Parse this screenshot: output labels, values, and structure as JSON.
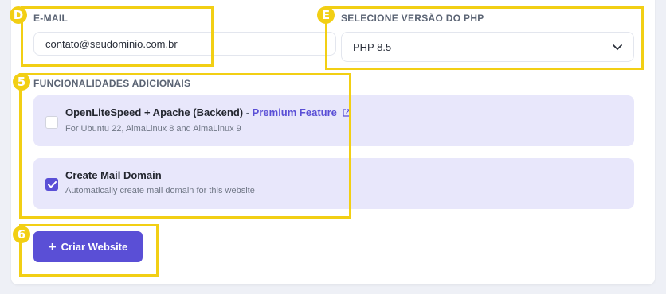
{
  "email": {
    "label": "E-MAIL",
    "value": "contato@seudominio.com.br"
  },
  "php": {
    "label": "SELECIONE VERSÃO DO PHP",
    "selected": "PHP 8.5"
  },
  "features": {
    "label": "FUNCIONALIDADES ADICIONAIS",
    "items": [
      {
        "title": "OpenLiteSpeed + Apache (Backend)",
        "separator": " - ",
        "premium": "Premium Feature",
        "description": "For Ubuntu 22, AlmaLinux 8 and AlmaLinux 9",
        "checked": false
      },
      {
        "title": "Create Mail Domain",
        "description": "Automatically create mail domain for this website",
        "checked": true
      }
    ]
  },
  "submit": {
    "icon": "+",
    "label": "Criar Website"
  },
  "annotations": {
    "badges": [
      "D",
      "E",
      "5",
      "6"
    ],
    "highlight_color": "#f2cf14"
  },
  "colors": {
    "accent": "#5a4fd6",
    "feature_bg": "#e8e7fb"
  }
}
